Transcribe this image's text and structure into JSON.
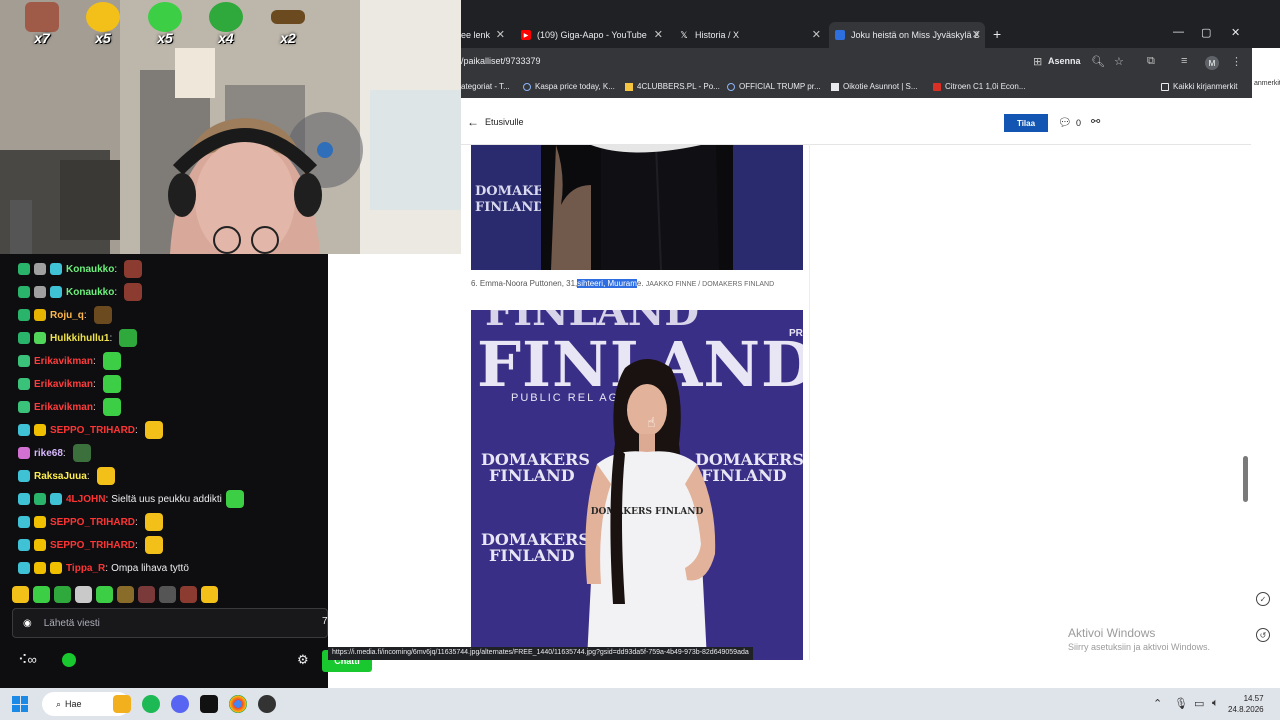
{
  "colors": {
    "chrome_dark": "#202124",
    "chrome_mid": "#35363a",
    "subscribe_blue": "#1255b3",
    "highlight": "#2f6ee0",
    "twitch_bg": "#0e0e10",
    "chat_green": "#19c82f"
  },
  "webcam": {
    "emote_counts": [
      {
        "icon": "face-emote",
        "count": "x7"
      },
      {
        "icon": "duck-emote",
        "count": "x5"
      },
      {
        "icon": "green-blob-emote",
        "count": "x5"
      },
      {
        "icon": "green-pepe-emote",
        "count": "x4"
      },
      {
        "icon": "bar-emote",
        "count": "x2"
      }
    ]
  },
  "browser": {
    "tabs": [
      {
        "label": "ee lenk",
        "icon": "page-icon"
      },
      {
        "label": "(109) Giga-Aapo - YouTube",
        "icon": "youtube-icon"
      },
      {
        "label": "Historia / X",
        "icon": "x-icon"
      },
      {
        "label": "Joku heistä on Miss Jyväskylä 2",
        "icon": "news-icon"
      }
    ],
    "url": "/paikalliset/9733379",
    "install_label": "Asenna",
    "profile_initial": "M",
    "bookmarks": [
      {
        "label": "ategoriat - T...",
        "icon": "page-icon"
      },
      {
        "label": "Kaspa price today, K...",
        "icon": "globe-icon"
      },
      {
        "label": "4CLUBBERS.PL - Po...",
        "icon": "star-icon"
      },
      {
        "label": "OFFICIAL TRUMP pr...",
        "icon": "globe-icon"
      },
      {
        "label": "Oikotie Asunnot | S...",
        "icon": "tag-icon"
      },
      {
        "label": "Citroen C1 1,0i Econ...",
        "icon": "n-icon"
      }
    ],
    "all_bookmarks": "Kaikki kirjanmerkit",
    "right_sliver_text": "anmerkit"
  },
  "article": {
    "back_label": "Etusivulle",
    "subscribe_label": "Tilaa",
    "comment_count": "0",
    "caption_before": "6. Emma-Noora Puttonen, 31,",
    "caption_highlight": "sihteeri, Muuram",
    "caption_after": "e.",
    "caption_credit": "JAAKKO FINNE / DOMAKERS FINLAND",
    "photo1_brand_lines": [
      "DOMAKERS",
      "FINLAND"
    ],
    "photo2_big_text": "FINLAND",
    "photo2_pr_text": "PUBLIC REL   AGENCY",
    "photo2_brand_lines": [
      "DOMAKERS",
      "FINLAND"
    ],
    "shirt_text": "DOMAKERS FINLAND",
    "pr_fragment": "PR"
  },
  "status_link": "https://i.media.fi/incoming/6mv6jq/11635744.jpg/alternates/FREE_1440/11635744.jpg?gsid=dd93da5f-759a-4b49-973b-82d649059ada",
  "activate_windows": {
    "title": "Aktivoi Windows",
    "subtitle": "Siirry asetuksiin ja aktivoi Windows."
  },
  "chat": {
    "messages": [
      {
        "badges": [
          "#2ab36a",
          "#a0a0a0",
          "#3fc2d6"
        ],
        "user": "Konaukko",
        "color": "#6cf07c",
        "text": "",
        "emote": "#8b3b30"
      },
      {
        "badges": [
          "#2ab36a",
          "#a0a0a0",
          "#3fc2d6"
        ],
        "user": "Konaukko",
        "color": "#6cf07c",
        "text": "",
        "emote": "#8b3b30"
      },
      {
        "badges": [
          "#2ab36a",
          "#e6b400"
        ],
        "user": "Roju_q",
        "color": "#ffb84d",
        "text": "",
        "emote": "#6b4a1f"
      },
      {
        "badges": [
          "#2ab36a",
          "#52d65a"
        ],
        "user": "Hulkkihullu1",
        "color": "#efe24b",
        "text": "",
        "emote": "#2fa83c"
      },
      {
        "badges": [
          "#3ac27a"
        ],
        "user": "Erikavikman",
        "color": "#ff3d3d",
        "text": "",
        "emote": "#3ccf46"
      },
      {
        "badges": [
          "#3ac27a"
        ],
        "user": "Erikavikman",
        "color": "#ff3d3d",
        "text": "",
        "emote": "#3ccf46"
      },
      {
        "badges": [
          "#3ac27a"
        ],
        "user": "Erikavikman",
        "color": "#ff3d3d",
        "text": "",
        "emote": "#3ccf46"
      },
      {
        "badges": [
          "#3fc2d6",
          "#f0c000"
        ],
        "user": "SEPPO_TRIHARD",
        "color": "#ff3535",
        "text": "",
        "emote": "#f2c019"
      },
      {
        "badges": [
          "#d271d2"
        ],
        "user": "rike68",
        "color": "#d9b8ff",
        "text": "",
        "emote": "#3b6f3c"
      },
      {
        "badges": [
          "#3fc2d6"
        ],
        "user": "RaksaJuua",
        "color": "#ffef4f",
        "text": "",
        "emote": "#f2c019"
      },
      {
        "badges": [
          "#3fc2d6",
          "#2ab36a",
          "#3fc2d6"
        ],
        "user": "4LJOHN",
        "color": "#ff3535",
        "text": "Sieltä uus peukku addikti",
        "emote": "#3ccf46"
      },
      {
        "badges": [
          "#3fc2d6",
          "#f0c000"
        ],
        "user": "SEPPO_TRIHARD",
        "color": "#ff3535",
        "text": "",
        "emote": "#f2c019"
      },
      {
        "badges": [
          "#3fc2d6",
          "#f0c000"
        ],
        "user": "SEPPO_TRIHARD",
        "color": "#ff3535",
        "text": "",
        "emote": "#f2c019"
      },
      {
        "badges": [
          "#3fc2d6",
          "#f0c000",
          "#f0c000"
        ],
        "user": "Tippa_R",
        "color": "#ff3535",
        "text": "Ompa lihava tyttö",
        "emote": ""
      }
    ],
    "emote_bar": [
      "#f2c019",
      "#3ccf46",
      "#2fa83c",
      "#c9c9c9",
      "#3ccf46",
      "#8a6c2a",
      "#7a3a3a",
      "#555",
      "#8b3b30",
      "#f2c019"
    ],
    "input_placeholder": "Lähetä viesti",
    "send_label": "Chatti",
    "side_count": "7"
  },
  "taskbar": {
    "search_label": "Hae",
    "time": "14.57",
    "date": "24.8.2026"
  }
}
